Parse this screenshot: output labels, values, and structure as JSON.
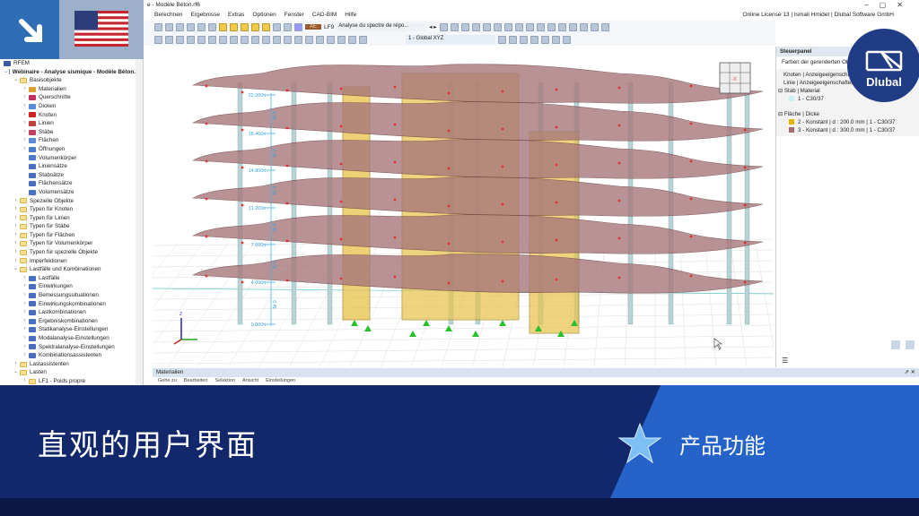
{
  "window": {
    "title": "e - Modèle Béton.rf6",
    "license": "Online License 13 | Ismail Hmidet | Dlubal Software GmbH"
  },
  "menu": [
    "Berechnen",
    "Ergebnisse",
    "Extras",
    "Optionen",
    "Fenster",
    "CAD-BIM",
    "Hilfe"
  ],
  "toolbar": {
    "lc_code": "AE",
    "lc_id": "LF9",
    "lc_name": "Analyse du spectre de répo...",
    "view": "1 - Global XYZ"
  },
  "tree": {
    "root": "RFEM",
    "items": [
      {
        "l": 0,
        "t": "v",
        "label": "Webinaire - Analyse sismique - Modèle Béton.rf6",
        "bold": true,
        "icon": "file"
      },
      {
        "l": 1,
        "t": "v",
        "label": "Basisobjekte",
        "icon": "folder"
      },
      {
        "l": 2,
        "t": ">",
        "label": "Materialien",
        "icon": "materials"
      },
      {
        "l": 2,
        "t": ">",
        "label": "Querschnitte",
        "icon": "section"
      },
      {
        "l": 2,
        "t": ">",
        "label": "Dicken",
        "icon": "thickness"
      },
      {
        "l": 2,
        "t": ">",
        "label": "Knoten",
        "icon": "node"
      },
      {
        "l": 2,
        "t": ">",
        "label": "Linien",
        "icon": "line"
      },
      {
        "l": 2,
        "t": ">",
        "label": "Stäbe",
        "icon": "member"
      },
      {
        "l": 2,
        "t": ">",
        "label": "Flächen",
        "icon": "surface"
      },
      {
        "l": 2,
        "t": ">",
        "label": "Öffnungen",
        "icon": "opening"
      },
      {
        "l": 2,
        "t": "",
        "label": "Volumenkörper",
        "icon": "solid"
      },
      {
        "l": 2,
        "t": "",
        "label": "Liniensätze",
        "icon": "line-set"
      },
      {
        "l": 2,
        "t": "",
        "label": "Stabsätze",
        "icon": "member-set"
      },
      {
        "l": 2,
        "t": "",
        "label": "Flächensätze",
        "icon": "surface-set"
      },
      {
        "l": 2,
        "t": "",
        "label": "Volumensätze",
        "icon": "solid-set"
      },
      {
        "l": 1,
        "t": ">",
        "label": "Spezielle Objekte",
        "icon": "folder"
      },
      {
        "l": 1,
        "t": ">",
        "label": "Typen für Knoten",
        "icon": "folder"
      },
      {
        "l": 1,
        "t": ">",
        "label": "Typen für Linien",
        "icon": "folder"
      },
      {
        "l": 1,
        "t": ">",
        "label": "Typen für Stäbe",
        "icon": "folder"
      },
      {
        "l": 1,
        "t": ">",
        "label": "Typen für Flächen",
        "icon": "folder"
      },
      {
        "l": 1,
        "t": ">",
        "label": "Typen für Volumenkörper",
        "icon": "folder"
      },
      {
        "l": 1,
        "t": ">",
        "label": "Typen für spezielle Objekte",
        "icon": "folder"
      },
      {
        "l": 1,
        "t": ">",
        "label": "Imperfektionen",
        "icon": "folder"
      },
      {
        "l": 1,
        "t": "v",
        "label": "Lastfälle und Kombinationen",
        "icon": "folder"
      },
      {
        "l": 2,
        "t": ">",
        "label": "Lastfälle",
        "icon": "load-case"
      },
      {
        "l": 2,
        "t": ">",
        "label": "Einwirkungen",
        "icon": "action"
      },
      {
        "l": 2,
        "t": ">",
        "label": "Bemessungssituationen",
        "icon": "design-situation"
      },
      {
        "l": 2,
        "t": ">",
        "label": "Einwirkungskombinationen",
        "icon": "action-combo"
      },
      {
        "l": 2,
        "t": ">",
        "label": "Lastkombinationen",
        "icon": "load-combo"
      },
      {
        "l": 2,
        "t": ">",
        "label": "Ergebniskombinationen",
        "icon": "result-combo"
      },
      {
        "l": 2,
        "t": ">",
        "label": "Statikanalyse-Einstellungen",
        "icon": "static-settings"
      },
      {
        "l": 2,
        "t": ">",
        "label": "Modalanalyse-Einstellungen",
        "icon": "modal-settings"
      },
      {
        "l": 2,
        "t": ">",
        "label": "Spektralanalyse-Einstellungen",
        "icon": "spectral-settings"
      },
      {
        "l": 2,
        "t": ">",
        "label": "Kombinationsassistenten",
        "icon": "combo-wizard"
      },
      {
        "l": 1,
        "t": ">",
        "label": "Lastassistenten",
        "icon": "folder"
      },
      {
        "l": 1,
        "t": "v",
        "label": "Lasten",
        "icon": "folder"
      },
      {
        "l": 2,
        "t": ">",
        "label": "LF1 - Poids propre",
        "icon": "folder"
      }
    ]
  },
  "model": {
    "levels": [
      {
        "label": "22.000m",
        "storey": "Nr.5"
      },
      {
        "label": "18.400m",
        "storey": "Nr.4"
      },
      {
        "label": "14.800m",
        "storey": "Nr.3"
      },
      {
        "label": "11.200m",
        "storey": "Nr.2"
      },
      {
        "label": "7.600m",
        "storey": "Nr.1"
      },
      {
        "label": "4.000m",
        "storey": "Nr.0"
      },
      {
        "label": "0.000m",
        "storey": ""
      }
    ],
    "nav_cube": "-X",
    "axis_z": "Z",
    "colors": {
      "slab": "#a7787a",
      "wall": "#e8c24a",
      "column": "#b8d3d6",
      "support": "#27c22b",
      "node": "#e03030"
    }
  },
  "control_panel": {
    "title": "Steuerpanel",
    "subtitle": "Farben der gerenderten Objekte",
    "lines": [
      "Knoten | Anzeigeeigenschaften",
      "Linie | Anzeigeeigenschaften"
    ],
    "member_header": "Stab | Material",
    "member_items": [
      {
        "label": "1 - C30/37",
        "color": "#c9f0f2"
      }
    ],
    "surface_header": "Fläche | Dicke",
    "surface_items": [
      {
        "label": "2 - Konstant | d : 200.0 mm | 1 - C30/37",
        "color": "#e8b400"
      },
      {
        "label": "3 - Konstant | d : 300.0 mm | 1 - C30/37",
        "color": "#a86b6b"
      }
    ]
  },
  "brand": "Dlubal",
  "bottom_panel": {
    "title": "Materialien",
    "menu": [
      "Gehe zu",
      "Bearbeiten",
      "Selektion",
      "Ansicht",
      "Einstellungen"
    ]
  },
  "banner": {
    "title": "直观的用户界面",
    "tag": "产品功能"
  }
}
